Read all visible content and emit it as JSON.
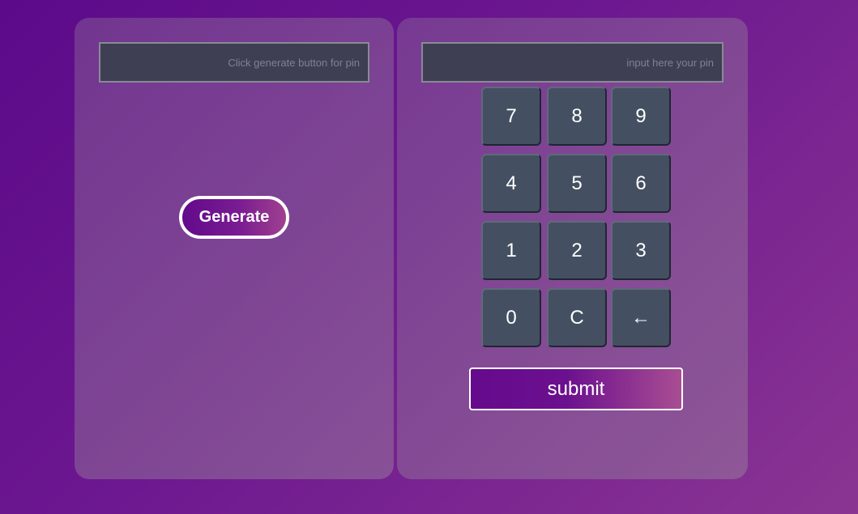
{
  "generator": {
    "pin_value": "",
    "pin_placeholder": "Click generate button for pin",
    "generate_label": "Generate"
  },
  "entry": {
    "input_value": "",
    "input_placeholder": "input here your pin",
    "keys": [
      {
        "label": "7"
      },
      {
        "label": "8"
      },
      {
        "label": "9"
      },
      {
        "label": "4"
      },
      {
        "label": "5"
      },
      {
        "label": "6"
      },
      {
        "label": "1"
      },
      {
        "label": "2"
      },
      {
        "label": "3"
      },
      {
        "label": "0"
      },
      {
        "label": "C"
      },
      {
        "label": "←"
      }
    ],
    "submit_label": "submit"
  }
}
